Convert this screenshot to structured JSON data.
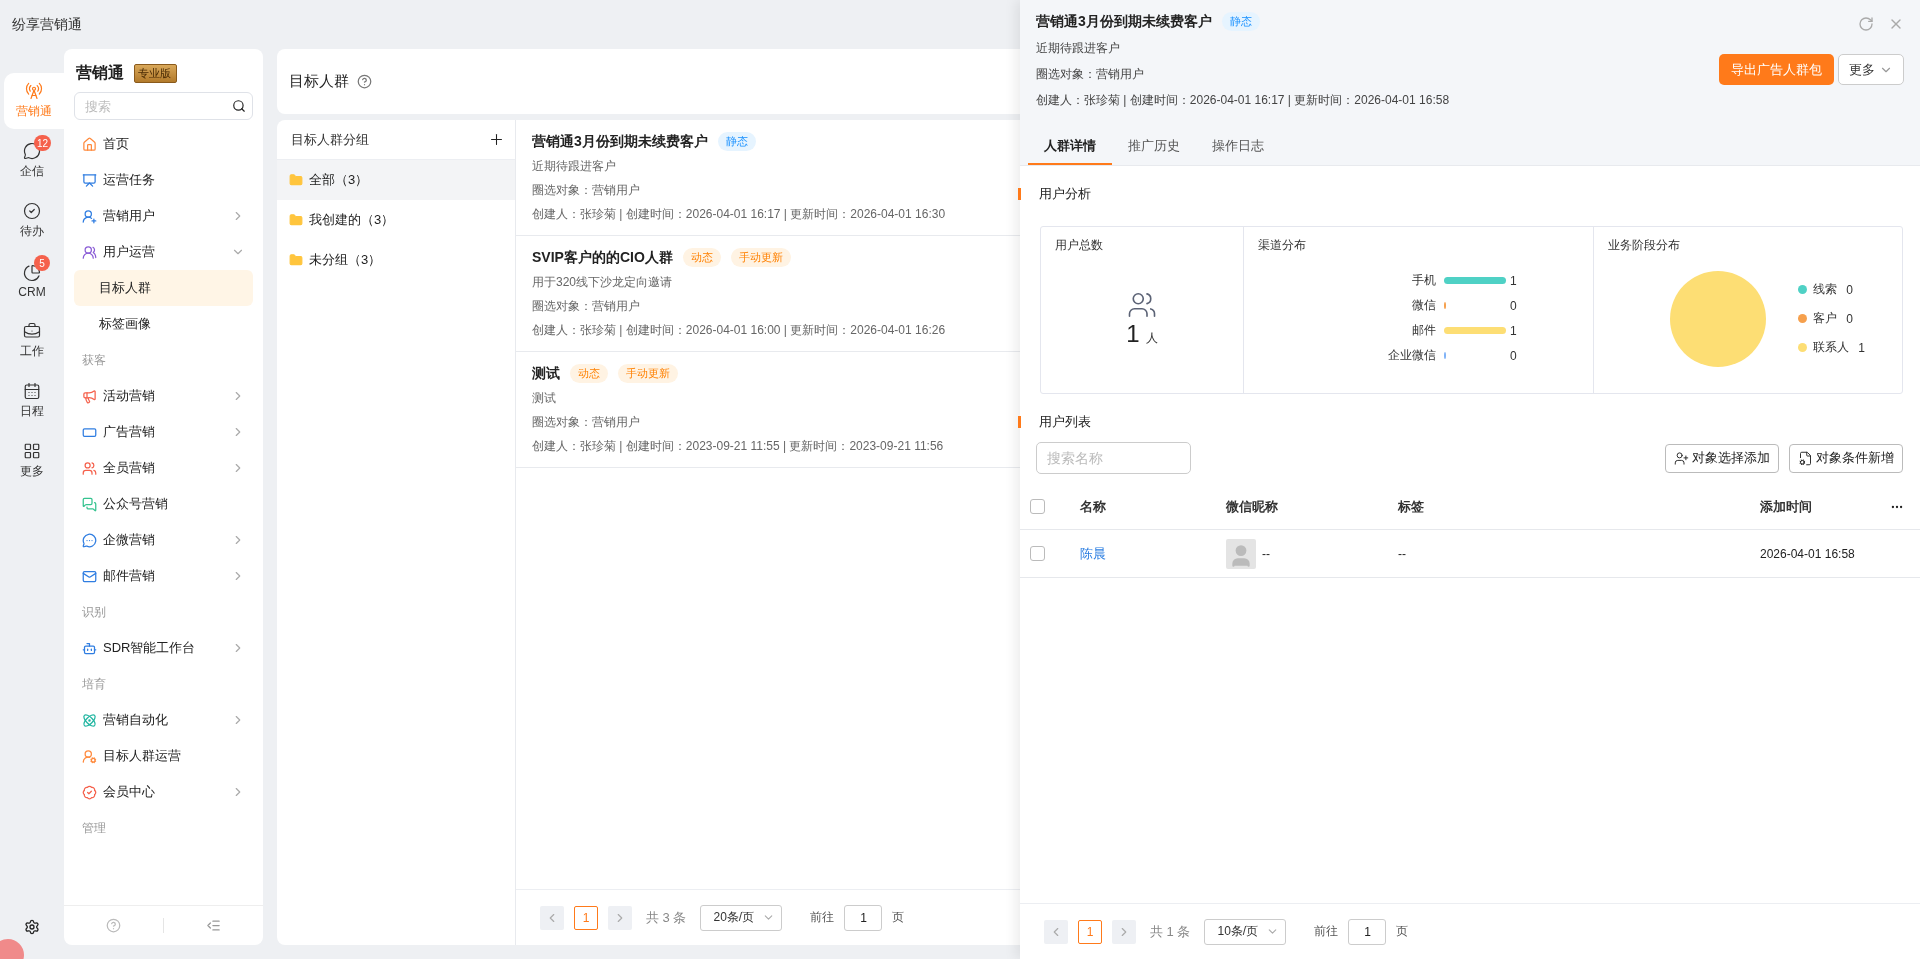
{
  "app_title": "纷享营销通",
  "rail": [
    {
      "label": "营销通",
      "selected": true
    },
    {
      "label": "企信",
      "badge": "12",
      "selected": false
    },
    {
      "label": "待办",
      "selected": false
    },
    {
      "label": "CRM",
      "badge": "5",
      "selected": false
    },
    {
      "label": "工作",
      "selected": false
    },
    {
      "label": "日程",
      "selected": false
    },
    {
      "label": "更多",
      "selected": false
    }
  ],
  "nav": {
    "title": "营销通",
    "edition": "专业版",
    "search_placeholder": "搜索",
    "items": [
      {
        "kind": "item",
        "label": "首页",
        "expandable": false,
        "selected": false
      },
      {
        "kind": "item",
        "label": "运营任务",
        "expandable": false,
        "selected": false
      },
      {
        "kind": "item",
        "label": "营销用户",
        "expandable": true,
        "expanded": false,
        "selected": false
      },
      {
        "kind": "item",
        "label": "用户运营",
        "expandable": true,
        "expanded": true,
        "selected": false,
        "children": [
          {
            "label": "目标人群",
            "selected": true
          },
          {
            "label": "标签画像",
            "selected": false
          }
        ]
      },
      {
        "kind": "section",
        "label": "获客"
      },
      {
        "kind": "item",
        "label": "活动营销",
        "expandable": true,
        "expanded": false,
        "selected": false
      },
      {
        "kind": "item",
        "label": "广告营销",
        "expandable": true,
        "expanded": false,
        "selected": false
      },
      {
        "kind": "item",
        "label": "全员营销",
        "expandable": true,
        "expanded": false,
        "selected": false
      },
      {
        "kind": "item",
        "label": "公众号营销",
        "expandable": false,
        "selected": false
      },
      {
        "kind": "item",
        "label": "企微营销",
        "expandable": true,
        "expanded": false,
        "selected": false
      },
      {
        "kind": "item",
        "label": "邮件营销",
        "expandable": true,
        "expanded": false,
        "selected": false
      },
      {
        "kind": "section",
        "label": "识别"
      },
      {
        "kind": "item",
        "label": "SDR智能工作台",
        "expandable": true,
        "expanded": false,
        "selected": false
      },
      {
        "kind": "section",
        "label": "培育"
      },
      {
        "kind": "item",
        "label": "营销自动化",
        "expandable": true,
        "expanded": false,
        "selected": false
      },
      {
        "kind": "item",
        "label": "目标人群运营",
        "expandable": false,
        "selected": false
      },
      {
        "kind": "item",
        "label": "会员中心",
        "expandable": true,
        "expanded": false,
        "selected": false
      },
      {
        "kind": "section",
        "label": "管理"
      }
    ]
  },
  "page": {
    "title": "目标人群",
    "groups": {
      "title": "目标人群分组",
      "items": [
        {
          "label": "全部（3）",
          "selected": true
        },
        {
          "label": "我创建的（3）",
          "selected": false
        },
        {
          "label": "未分组（3）",
          "selected": false
        }
      ]
    },
    "audiences": [
      {
        "title": "营销通3月份到期未续费客户",
        "tags": [
          {
            "label": "静态",
            "kind": "static"
          }
        ],
        "description": "近期待跟进客户",
        "scope": "圈选对象：营销用户",
        "meta": "创建人：张珍菊 | 创建时间：2026-04-01 16:17 | 更新时间：2026-04-01 16:30"
      },
      {
        "title": "SVIP客户的的CIO人群",
        "tags": [
          {
            "label": "动态",
            "kind": "dynamic"
          },
          {
            "label": "手动更新",
            "kind": "manual"
          }
        ],
        "description": "用于320线下沙龙定向邀请",
        "scope": "圈选对象：营销用户",
        "meta": "创建人：张珍菊 | 创建时间：2026-04-01 16:00 | 更新时间：2026-04-01 16:26"
      },
      {
        "title": "测试",
        "tags": [
          {
            "label": "动态",
            "kind": "dynamic"
          },
          {
            "label": "手动更新",
            "kind": "manual"
          }
        ],
        "description": "测试",
        "scope": "圈选对象：营销用户",
        "meta": "创建人：张珍菊 | 创建时间：2023-09-21 11:55 | 更新时间：2023-09-21 11:56"
      }
    ],
    "pagination": {
      "page": "1",
      "total": "共 3 条",
      "page_size": "20条/页",
      "goto_label": "前往",
      "goto_value": "1",
      "goto_unit": "页"
    }
  },
  "drawer": {
    "title": "营销通3月份到期未续费客户",
    "tag": {
      "label": "静态",
      "kind": "static"
    },
    "description": "近期待跟进客户",
    "scope": "圈选对象：营销用户",
    "meta": "创建人：张珍菊 | 创建时间：2026-04-01 16:17 | 更新时间：2026-04-01 16:58",
    "primary_button": "导出广告人群包",
    "more_button": "更多",
    "tabs": [
      {
        "label": "人群详情",
        "selected": true
      },
      {
        "label": "推广历史",
        "selected": false
      },
      {
        "label": "操作日志",
        "selected": false
      }
    ],
    "analysis": {
      "title": "用户分析",
      "total": {
        "title": "用户总数",
        "count": "1",
        "unit": "人"
      },
      "channels": {
        "title": "渠道分布",
        "chart_data": {
          "type": "bar",
          "orientation": "horizontal",
          "categories": [
            "手机",
            "微信",
            "邮件",
            "企业微信"
          ],
          "values": [
            1,
            0,
            1,
            0
          ],
          "data_labels": true
        }
      },
      "stages": {
        "title": "业务阶段分布",
        "items": [
          {
            "label": "线索",
            "count": "0",
            "color": "#4fd1c5"
          },
          {
            "label": "客户",
            "count": "0",
            "color": "#f6a04d"
          },
          {
            "label": "联系人",
            "count": "1",
            "color": "#fdde74"
          }
        ]
      }
    },
    "users": {
      "title": "用户列表",
      "search_placeholder": "搜索名称",
      "buttons": [
        "对象选择添加",
        "对象条件新增"
      ],
      "columns": [
        "名称",
        "微信昵称",
        "标签",
        "添加时间"
      ],
      "all_checked": false,
      "rows": [
        {
          "name": "陈晨",
          "nickname": "--",
          "tags": "--",
          "added": "2026-04-01 16:58",
          "checked": false
        }
      ]
    },
    "pagination": {
      "page": "1",
      "total": "共 1 条",
      "page_size": "10条/页",
      "goto_label": "前往",
      "goto_value": "1",
      "goto_unit": "页"
    }
  }
}
